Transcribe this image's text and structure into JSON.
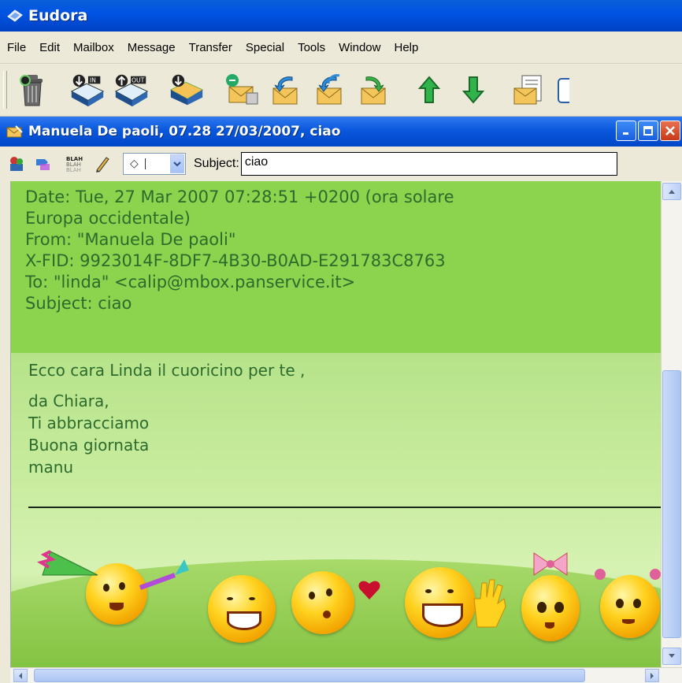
{
  "app": {
    "title": "Eudora"
  },
  "menu": [
    "File",
    "Edit",
    "Mailbox",
    "Message",
    "Transfer",
    "Special",
    "Tools",
    "Window",
    "Help"
  ],
  "toolbar": {
    "icons": [
      "trash-icon",
      "check-mail-in-icon",
      "send-out-icon",
      "new-message-icon",
      "reply-icon",
      "reply-all-icon",
      "forward-icon",
      "redirect-icon",
      "previous-message-icon",
      "next-message-icon",
      "attach-icon",
      "address-book-icon"
    ]
  },
  "message_window": {
    "title": "Manuela De paoli, 07.28 27/03/2007, ciao"
  },
  "message_toolbar": {
    "priority_symbol": "◇",
    "subject_label": "Subject:",
    "subject_value": "ciao"
  },
  "headers": {
    "date_line1": "Date: Tue, 27 Mar 2007 07:28:51 +0200 (ora solare",
    "date_line2": "Europa occidentale)",
    "from": "From: \"Manuela De paoli\"",
    "xfid": "X-FID: 9923014F-8DF7-4B30-B0AD-E291783C8763",
    "to": "To: \"linda\" <calip@mbox.panservice.it>",
    "subject": "Subject: ciao"
  },
  "body": {
    "line1": "Ecco cara Linda il cuoricino per te ,",
    "line2": "da Chiara,",
    "line3": "Ti abbracciamo",
    "line4": "Buona giornata",
    "line5": "manu"
  },
  "colors": {
    "title_blue": "#0054e3",
    "header_bg": "#8cd34e",
    "text_green": "#2d6b2d",
    "chrome": "#ece9d8"
  }
}
